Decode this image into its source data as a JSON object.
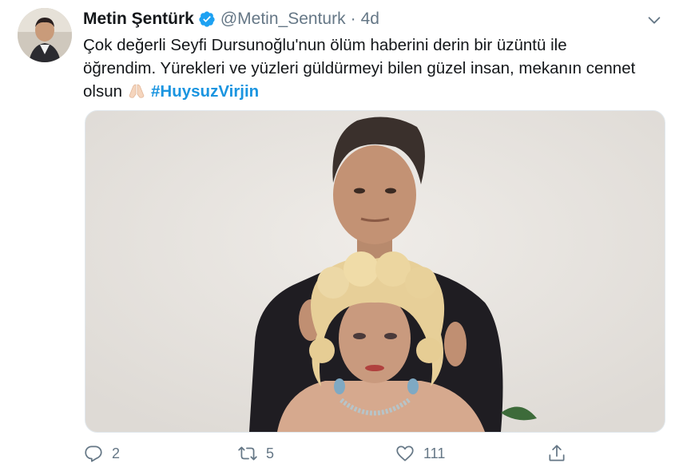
{
  "author": {
    "display_name": "Metin Şentürk",
    "handle": "@Metin_Senturk",
    "separator": "·",
    "time": "4d"
  },
  "text": {
    "line1": "Çok değerli Seyfi Dursunoğlu'nun ölüm haberini derin bir üzüntü ile",
    "line2": "öğrendim. Yürekleri ve yüzleri güldürmeyi bilen güzel insan, mekanın cennet",
    "line3_prefix": "olsun",
    "hashtag": "#HuysuzVirjin"
  },
  "actions": {
    "reply_count": "2",
    "retweet_count": "5",
    "like_count": "111"
  },
  "colors": {
    "accent": "#1b95e0",
    "secondary_text": "#657786"
  },
  "icons": [
    "verified-badge-icon",
    "chevron-down-icon",
    "praying-hands-emoji",
    "reply-icon",
    "retweet-icon",
    "like-icon",
    "share-icon"
  ]
}
